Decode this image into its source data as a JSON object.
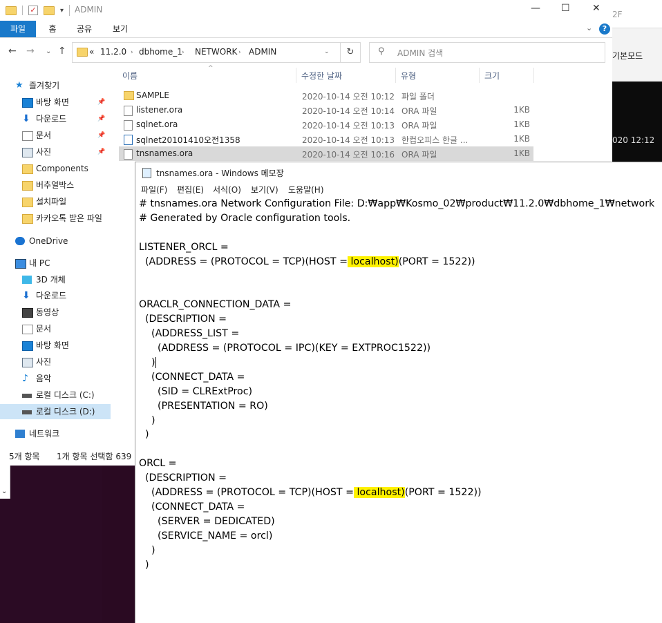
{
  "background": {
    "right_code": "2F",
    "right_mode": "기본모드",
    "right_time": "020 12:12"
  },
  "explorer": {
    "title": "ADMIN",
    "ribbon_tabs": [
      "파일",
      "홈",
      "공유",
      "보기"
    ],
    "path": [
      "«",
      "11.2.0",
      "dbhome_1",
      "NETWORK",
      "ADMIN"
    ],
    "search_placeholder": "ADMIN 검색",
    "headers": {
      "name": "이름",
      "date": "수정한 날짜",
      "type": "유형",
      "size": "크기"
    },
    "sidebar": [
      {
        "label": "즐겨찾기",
        "icon": "star-icon"
      },
      {
        "label": "바탕 화면",
        "icon": "desktop-icon",
        "pinned": true
      },
      {
        "label": "다운로드",
        "icon": "download-icon",
        "pinned": true
      },
      {
        "label": "문서",
        "icon": "document-icon",
        "pinned": true
      },
      {
        "label": "사진",
        "icon": "pictures-icon",
        "pinned": true
      },
      {
        "label": "Components",
        "icon": "folder-icon"
      },
      {
        "label": "버추얼박스",
        "icon": "folder-icon"
      },
      {
        "label": "설치파일",
        "icon": "folder-icon"
      },
      {
        "label": "카카오톡 받은 파일",
        "icon": "folder-icon"
      },
      {
        "label": "OneDrive",
        "icon": "onedrive-icon"
      },
      {
        "label": "내 PC",
        "icon": "pc-icon"
      },
      {
        "label": "3D 개체",
        "icon": "3d-objects-icon"
      },
      {
        "label": "다운로드",
        "icon": "download-icon"
      },
      {
        "label": "동영상",
        "icon": "video-icon"
      },
      {
        "label": "문서",
        "icon": "document-icon"
      },
      {
        "label": "바탕 화면",
        "icon": "desktop-icon"
      },
      {
        "label": "사진",
        "icon": "pictures-icon"
      },
      {
        "label": "음악",
        "icon": "music-icon"
      },
      {
        "label": "로컬 디스크 (C:)",
        "icon": "drive-icon"
      },
      {
        "label": "로컬 디스크 (D:)",
        "icon": "drive-icon",
        "selected": true
      },
      {
        "label": "네트워크",
        "icon": "network-icon"
      }
    ],
    "files": [
      {
        "name": "SAMPLE",
        "date": "2020-10-14 오전 10:12",
        "type": "파일 폴더",
        "size": "",
        "icon": "folder-icon"
      },
      {
        "name": "listener.ora",
        "date": "2020-10-14 오전 10:14",
        "type": "ORA 파일",
        "size": "1KB",
        "icon": "file-icon"
      },
      {
        "name": "sqlnet.ora",
        "date": "2020-10-14 오전 10:13",
        "type": "ORA 파일",
        "size": "1KB",
        "icon": "file-icon"
      },
      {
        "name": "sqlnet20101410오전1358",
        "date": "2020-10-14 오전 10:13",
        "type": "한컴오피스 한글 ...",
        "size": "1KB",
        "icon": "hwp-icon"
      },
      {
        "name": "tnsnames.ora",
        "date": "2020-10-14 오전 10:16",
        "type": "ORA 파일",
        "size": "1KB",
        "icon": "file-icon",
        "selected": true
      }
    ],
    "status": {
      "count": "5개 항목",
      "selection": "1개 항목 선택함 639"
    }
  },
  "notepad": {
    "title": "tnsnames.ora - Windows 메모장",
    "menu": [
      "파일(F)",
      "편집(E)",
      "서식(O)",
      "보기(V)",
      "도움말(H)"
    ],
    "lines": [
      "# tnsnames.ora Network Configuration File: D:₩app₩Kosmo_02₩product₩11.2.0₩dbhome_1₩network",
      "# Generated by Oracle configuration tools.",
      "",
      "LISTENER_ORCL =",
      "  (ADDRESS = (PROTOCOL = TCP)(HOST = localhost)(PORT = 1522))",
      "",
      "",
      "ORACLR_CONNECTION_DATA =",
      "  (DESCRIPTION =",
      "    (ADDRESS_LIST =",
      "      (ADDRESS = (PROTOCOL = IPC)(KEY = EXTPROC1522))",
      "    )",
      "    (CONNECT_DATA =",
      "      (SID = CLRExtProc)",
      "      (PRESENTATION = RO)",
      "    )",
      "  )",
      "",
      "ORCL =",
      "  (DESCRIPTION =",
      "    (ADDRESS = (PROTOCOL = TCP)(HOST = localhost)(PORT = 1522))",
      "    (CONNECT_DATA =",
      "      (SERVER = DEDICATED)",
      "      (SERVICE_NAME = orcl)",
      "    )",
      "  )"
    ],
    "highlight_word": "localhost",
    "highlight_color": "#fff200",
    "cursor_line": 11
  },
  "colors": {
    "accent": "#1979ca",
    "selection": "#cce4f7"
  }
}
